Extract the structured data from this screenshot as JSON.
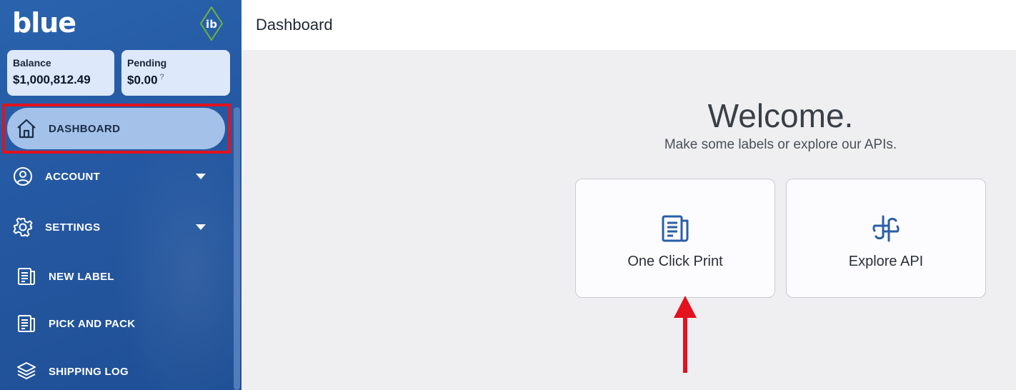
{
  "sidebar": {
    "brand": "blue",
    "logo_text": "ib",
    "balance": {
      "label": "Balance",
      "value": "$1,000,812.49"
    },
    "pending": {
      "label": "Pending",
      "value": "$0.00",
      "help": "?"
    },
    "items": [
      {
        "label": "DASHBOARD",
        "icon": "home-icon",
        "active": true
      },
      {
        "label": "ACCOUNT",
        "icon": "user-circle-icon",
        "expandable": true
      },
      {
        "label": "SETTINGS",
        "icon": "gear-icon",
        "expandable": true
      },
      {
        "label": "NEW LABEL",
        "icon": "document-icon"
      },
      {
        "label": "PICK AND PACK",
        "icon": "document-icon"
      },
      {
        "label": "SHIPPING LOG",
        "icon": "layers-icon"
      }
    ]
  },
  "header": {
    "title": "Dashboard"
  },
  "main": {
    "welcome_title": "Welcome.",
    "welcome_subtitle": "Make some labels or explore our APIs.",
    "cards": [
      {
        "label": "One Click Print",
        "icon": "document-icon"
      },
      {
        "label": "Explore API",
        "icon": "api-icon"
      }
    ]
  },
  "colors": {
    "sidebar_bg": "#2559a3",
    "active_item_bg": "#a4c1e9",
    "highlight_red": "#e2121e",
    "icon_blue": "#2a5ea6",
    "logo_green": "#6db33f"
  }
}
